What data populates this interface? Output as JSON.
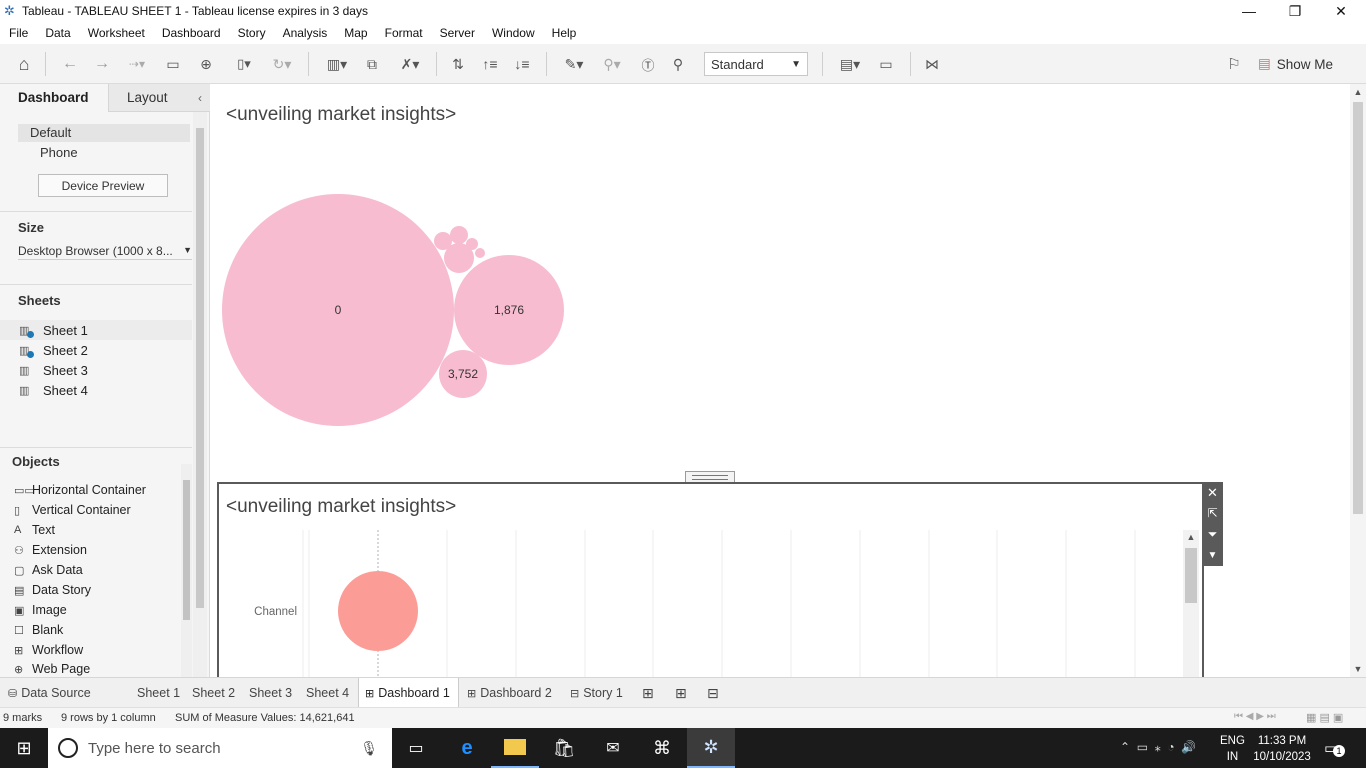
{
  "window": {
    "title": "Tableau - TABLEAU SHEET 1 - Tableau license expires in 3 days"
  },
  "menu": [
    "File",
    "Data",
    "Worksheet",
    "Dashboard",
    "Story",
    "Analysis",
    "Map",
    "Format",
    "Server",
    "Window",
    "Help"
  ],
  "toolbar": {
    "view_select": "Standard",
    "show_me": "Show Me"
  },
  "left_pane": {
    "tabs": {
      "dashboard": "Dashboard",
      "layout": "Layout"
    },
    "device": {
      "default": "Default",
      "phone": "Phone",
      "preview_button": "Device Preview"
    },
    "size": {
      "header": "Size",
      "value": "Desktop Browser (1000 x 8..."
    },
    "sheets": {
      "header": "Sheets",
      "items": [
        "Sheet 1",
        "Sheet 2",
        "Sheet 3",
        "Sheet 4"
      ]
    },
    "objects": {
      "header": "Objects",
      "items": [
        {
          "label": "Horizontal Container",
          "icon": "horizontal-container-icon"
        },
        {
          "label": "Vertical Container",
          "icon": "vertical-container-icon"
        },
        {
          "label": "Text",
          "icon": "text-icon"
        },
        {
          "label": "Extension",
          "icon": "extension-icon"
        },
        {
          "label": "Ask Data",
          "icon": "ask-data-icon"
        },
        {
          "label": "Data Story",
          "icon": "data-story-icon"
        },
        {
          "label": "Image",
          "icon": "image-icon"
        },
        {
          "label": "Blank",
          "icon": "blank-icon"
        },
        {
          "label": "Workflow",
          "icon": "workflow-icon"
        },
        {
          "label": "Web Page",
          "icon": "web-page-icon"
        }
      ]
    }
  },
  "dashboard": {
    "sheet1_title": "<unveiling market insights>",
    "sheet2_title": "<unveiling market insights>",
    "bubble_labels": [
      "0",
      "1,876",
      "3,752"
    ],
    "row_label": "Channel"
  },
  "chart_data": [
    {
      "type": "scatter",
      "title": "<unveiling market insights>",
      "data_labels": [
        "0",
        "1,876",
        "3,752"
      ],
      "marks": 9,
      "color": "#f7bcd0"
    },
    {
      "type": "scatter",
      "title": "<unveiling market insights>",
      "row_header": "Channel",
      "color": "#fc9c97"
    }
  ],
  "bottom_tabs": {
    "data_source": "Data Source",
    "tabs": [
      "Sheet 1",
      "Sheet 2",
      "Sheet 3",
      "Sheet 4",
      "Dashboard 1",
      "Dashboard 2",
      "Story 1"
    ]
  },
  "status": {
    "marks": "9 marks",
    "rows": "9 rows by 1 column",
    "sum": "SUM of Measure Values: 14,621,641"
  },
  "taskbar": {
    "search_placeholder": "Type here to search",
    "lang1": "ENG",
    "lang2": "IN",
    "time": "11:33 PM",
    "date": "10/10/2023",
    "notifications": "1"
  },
  "colors": {
    "bubble_pink": "#f7bcd0",
    "bubble_coral": "#fc9c97",
    "accent": "#1f77b4"
  }
}
